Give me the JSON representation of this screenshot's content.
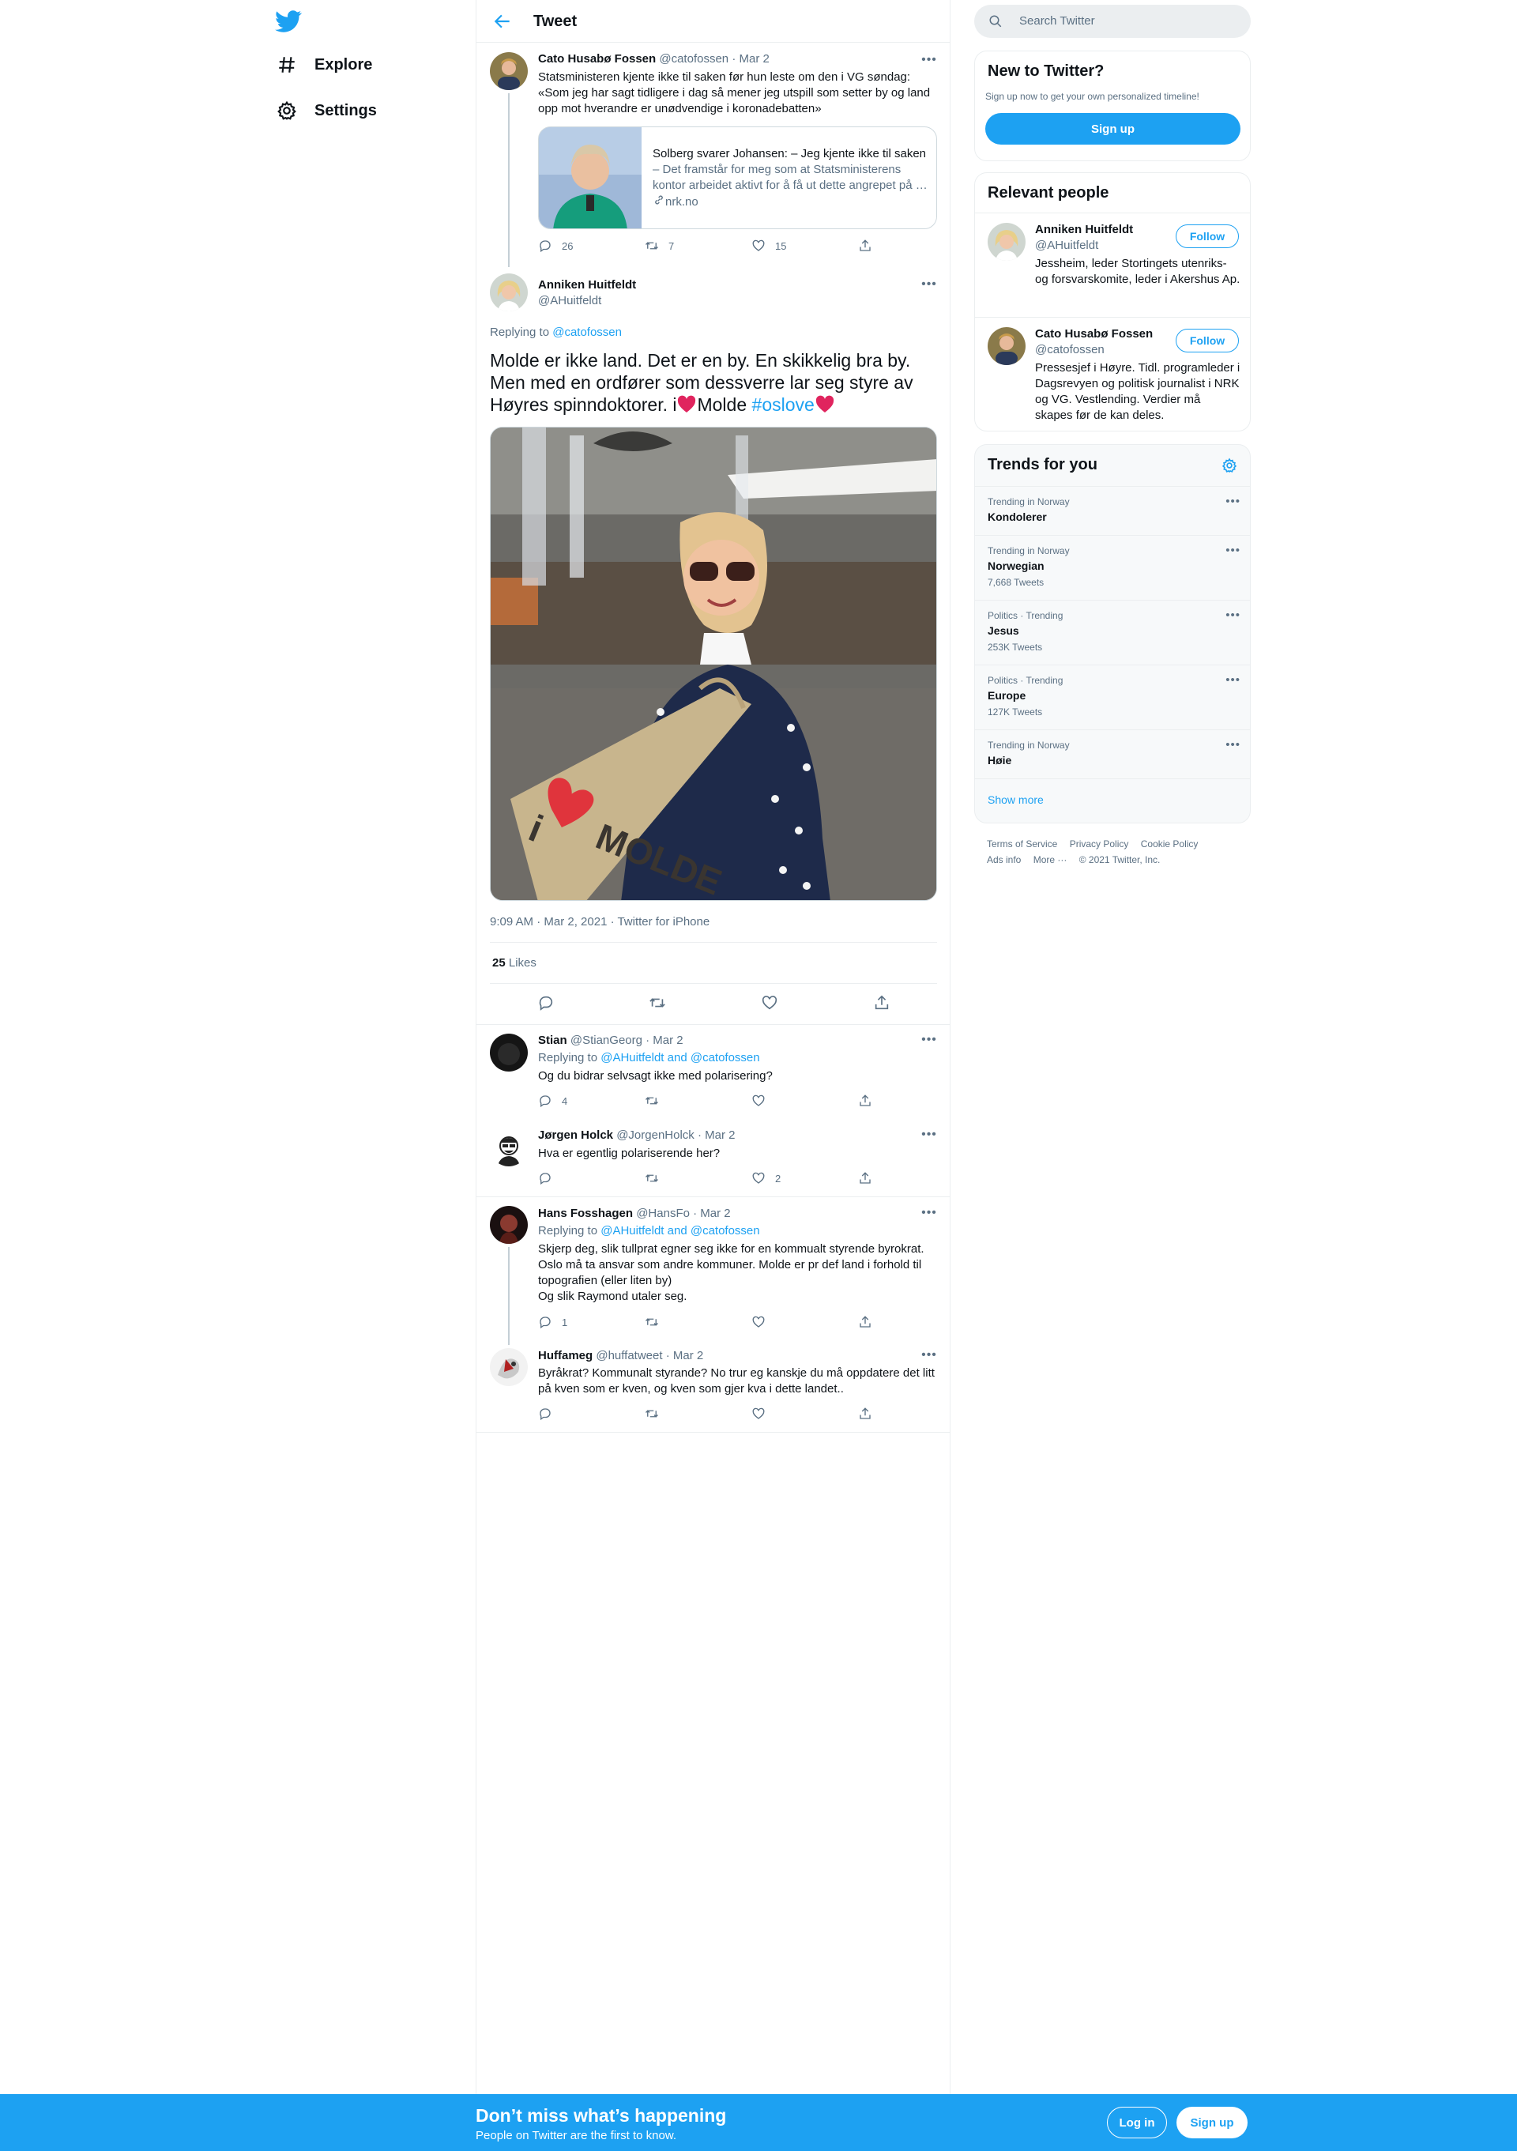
{
  "colors": {
    "accent": "#1da1f2",
    "muted": "#5b7083",
    "heart": "#e0245e",
    "border": "#ebeef0"
  },
  "nav": {
    "logo_icon": "twitter-bird-icon",
    "items": [
      {
        "label": "Explore",
        "icon": "hashtag-icon"
      },
      {
        "label": "Settings",
        "icon": "gear-icon"
      }
    ]
  },
  "header": {
    "title": "Tweet",
    "back_icon": "arrow-left-icon"
  },
  "parent_tweet": {
    "name": "Cato Husabø Fossen",
    "handle": "@catofossen",
    "date": "· Mar 2",
    "text": "Statsministeren kjente ikke til saken før hun leste om den i VG søndag: «Som jeg har sagt tidligere i dag så mener jeg utspill som setter by og land opp mot hverandre er unødvendige i koronadebatten»",
    "card": {
      "title": "Solberg svarer Johansen: – Jeg kjente ikke til saken",
      "description": "– Det framstår for meg som at Statsministerens kontor arbeidet aktivt for å få ut dette angrepet på …",
      "domain": "nrk.no"
    },
    "replies": "26",
    "retweets": "7",
    "likes": "15"
  },
  "main_tweet": {
    "name": "Anniken Huitfeldt",
    "handle": "@AHuitfeldt",
    "replying_prefix": "Replying to",
    "replying_to": "@catofossen",
    "text_part1": "Molde er ikke land. Det er en by. En skikkelig bra by. Men med en ordfører som dessverre lar seg styre av Høyres spinndoktorer. i",
    "text_part2": "Molde",
    "hashtag": "#oslove",
    "photo_bag_text": "MOLDE",
    "photo_bag_i": "i",
    "timestamp": "9:09 AM · Mar 2, 2021 · Twitter for iPhone",
    "likes_count": "25",
    "likes_label": "Likes"
  },
  "replies": [
    {
      "name": "Stian",
      "handle": "@StianGeorg",
      "date": "· Mar 2",
      "replying": "Replying to",
      "mentions": "@AHuitfeldt and @catofossen",
      "text": "Og du bidrar selvsagt ikke med polarisering?",
      "replies": "4",
      "retweets": "",
      "likes": ""
    },
    {
      "name": "Jørgen Holck",
      "handle": "@JorgenHolck",
      "date": "· Mar 2",
      "text": "Hva er egentlig polariserende her?",
      "replies": "",
      "retweets": "",
      "likes": "2"
    },
    {
      "name": "Hans Fosshagen",
      "handle": "@HansFo",
      "date": "· Mar 2",
      "replying": "Replying to",
      "mentions": "@AHuitfeldt and @catofossen",
      "text_lines": [
        "Skjerp deg, slik tullprat egner seg ikke for en kommualt styrende byrokrat.",
        "Oslo må ta ansvar som andre kommuner. Molde er pr def land i forhold til topografien (eller liten by)",
        "Og slik Raymond utaler seg."
      ],
      "replies": "1",
      "retweets": "",
      "likes": ""
    },
    {
      "name": "Huffameg",
      "handle": "@huffatweet",
      "date": "· Mar 2",
      "text": "Byråkrat? Kommunalt styrande? No trur eg kanskje du må oppdatere det litt på kven som er kven, og kven som gjer kva i dette landet..",
      "replies": "",
      "retweets": "",
      "likes": ""
    }
  ],
  "search": {
    "placeholder": "Search Twitter"
  },
  "new_to_twitter": {
    "title": "New to Twitter?",
    "subtitle": "Sign up now to get your own personalized timeline!",
    "button": "Sign up"
  },
  "relevant_people": {
    "title": "Relevant people",
    "people": [
      {
        "name": "Anniken Huitfeldt",
        "handle": "@AHuitfeldt",
        "bio": "Jessheim, leder Stortingets utenriks- og forsvarskomite, leder i Akershus Ap.",
        "button": "Follow"
      },
      {
        "name": "Cato Husabø Fossen",
        "handle": "@catofossen",
        "bio": "Pressesjef i Høyre. Tidl. programleder i Dagsrevyen og politisk journalist i NRK og VG. Vestlending. Verdier må skapes før de kan deles.",
        "button": "Follow"
      }
    ]
  },
  "trends": {
    "title": "Trends for you",
    "items": [
      {
        "context": "Trending in Norway",
        "name": "Kondolerer",
        "count": ""
      },
      {
        "context": "Trending in Norway",
        "name": "Norwegian",
        "count": "7,668 Tweets"
      },
      {
        "context": "Politics · Trending",
        "name": "Jesus",
        "count": "253K Tweets"
      },
      {
        "context": "Politics · Trending",
        "name": "Europe",
        "count": "127K Tweets"
      },
      {
        "context": "Trending in Norway",
        "name": "Høie",
        "count": ""
      }
    ],
    "show_more": "Show more"
  },
  "footer": {
    "links": [
      "Terms of Service",
      "Privacy Policy",
      "Cookie Policy",
      "Ads info",
      "More ···",
      "© 2021 Twitter, Inc."
    ]
  },
  "bottom_bar": {
    "title": "Don’t miss what’s happening",
    "subtitle": "People on Twitter are the first to know.",
    "login": "Log in",
    "signup": "Sign up"
  }
}
